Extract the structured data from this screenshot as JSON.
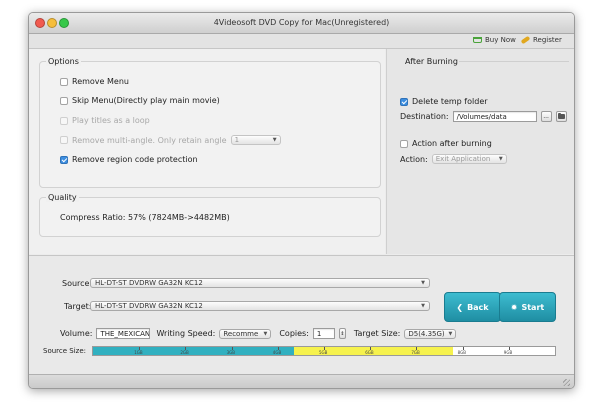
{
  "window": {
    "title": "4Videosoft DVD Copy for Mac(Unregistered)"
  },
  "toolbar": {
    "buy_now": "Buy Now",
    "register": "Register"
  },
  "options": {
    "title": "Options",
    "remove_menu": "Remove Menu",
    "skip_menu": "Skip Menu(Directly play main movie)",
    "play_titles_loop": "Play titles as a loop",
    "remove_multi_angle": "Remove multi-angle. Only retain angle",
    "angle_value": "1",
    "remove_region": "Remove region code protection"
  },
  "quality": {
    "title": "Quality",
    "compress_ratio": "Compress Ratio:  57%  (7824MB->4482MB)"
  },
  "after_burning": {
    "title": "After Burning",
    "delete_temp": "Delete temp folder",
    "destination_label": "Destination:",
    "destination_value": "/Volumes/data",
    "browse_label": "...",
    "action_after": "Action after burning",
    "action_label": "Action:",
    "action_value": "Exit Application"
  },
  "bottom": {
    "source_label": "Source:",
    "source_value": "HL-DT-ST DVDRW  GA32N KC12",
    "target_label": "Target:",
    "target_value": "HL-DT-ST DVDRW  GA32N KC12",
    "volume_label": "Volume:",
    "volume_value": "THE_MEXICAN",
    "writing_speed_label": "Writing Speed:",
    "writing_speed_value": "Recomme",
    "copies_label": "Copies:",
    "copies_value": "1",
    "target_size_label": "Target Size:",
    "target_size_value": "D5(4.35G)",
    "back_label": "Back",
    "start_label": "Start",
    "source_size_label": "Source Size:"
  },
  "size_bar": {
    "ticks": [
      "1GB",
      "2GB",
      "3GB",
      "4GB",
      "5GB",
      "6GB",
      "7GB",
      "8GB",
      "9GB"
    ],
    "max_gb": 10,
    "teal_until_gb": 4.35,
    "yellow_until_gb": 7.8
  },
  "colors": {
    "teal": "#31b0c0",
    "yellow": "#f6f24d",
    "accent": "#1f8ea3"
  }
}
